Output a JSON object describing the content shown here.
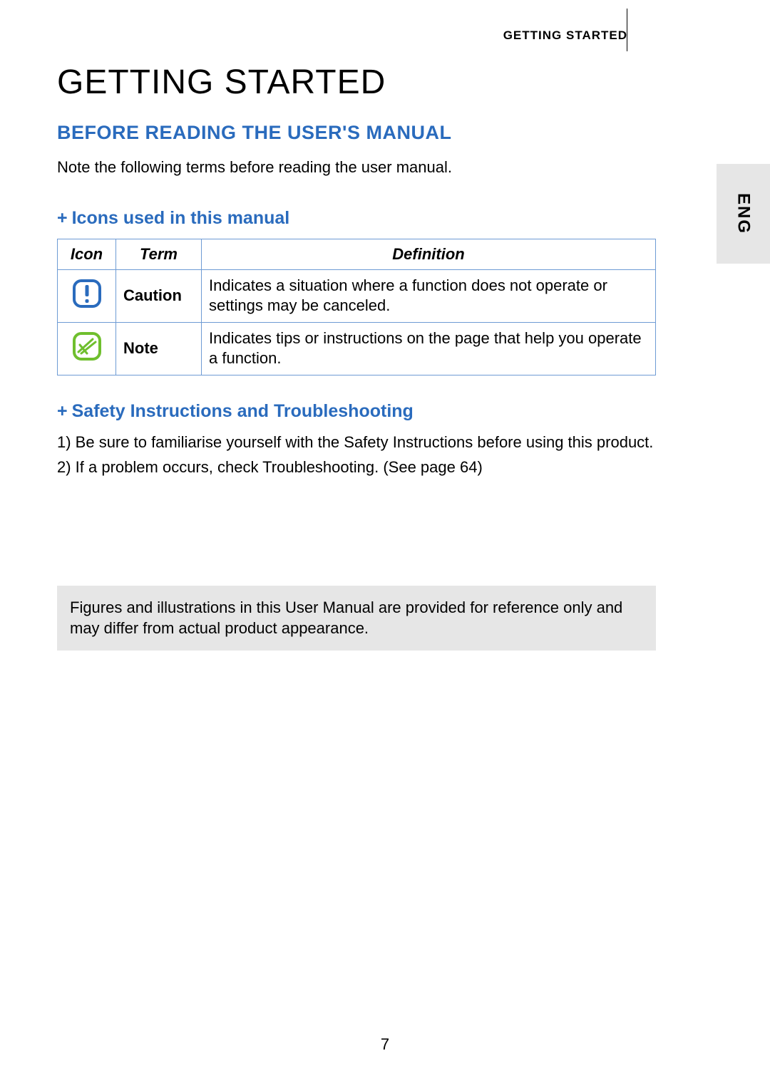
{
  "running_header": "GETTING STARTED",
  "side_tab": "ENG",
  "main_heading": "GETTING STARTED",
  "section_heading": "BEFORE READING THE USER'S MANUAL",
  "intro": "Note the following terms before reading the user manual.",
  "sub1": {
    "marker": "+",
    "title": "Icons used in this manual"
  },
  "table": {
    "headers": {
      "icon": "Icon",
      "term": "Term",
      "definition": "Definition"
    },
    "rows": [
      {
        "term": "Caution",
        "definition": "Indicates a situation where a function does not operate or settings may be canceled."
      },
      {
        "term": "Note",
        "definition": "Indicates tips or instructions on the page that help you operate a function."
      }
    ]
  },
  "sub2": {
    "marker": "+",
    "title": "Safety Instructions and Troubleshooting"
  },
  "list": {
    "item1": "1) Be sure to familiarise yourself with the Safety Instructions before using this product.",
    "item2": "2) If a problem occurs, check Troubleshooting. (See page 64)"
  },
  "disclaimer": "Figures and illustrations in this User Manual are provided for reference only and may differ from actual product appearance.",
  "page_number": "7"
}
